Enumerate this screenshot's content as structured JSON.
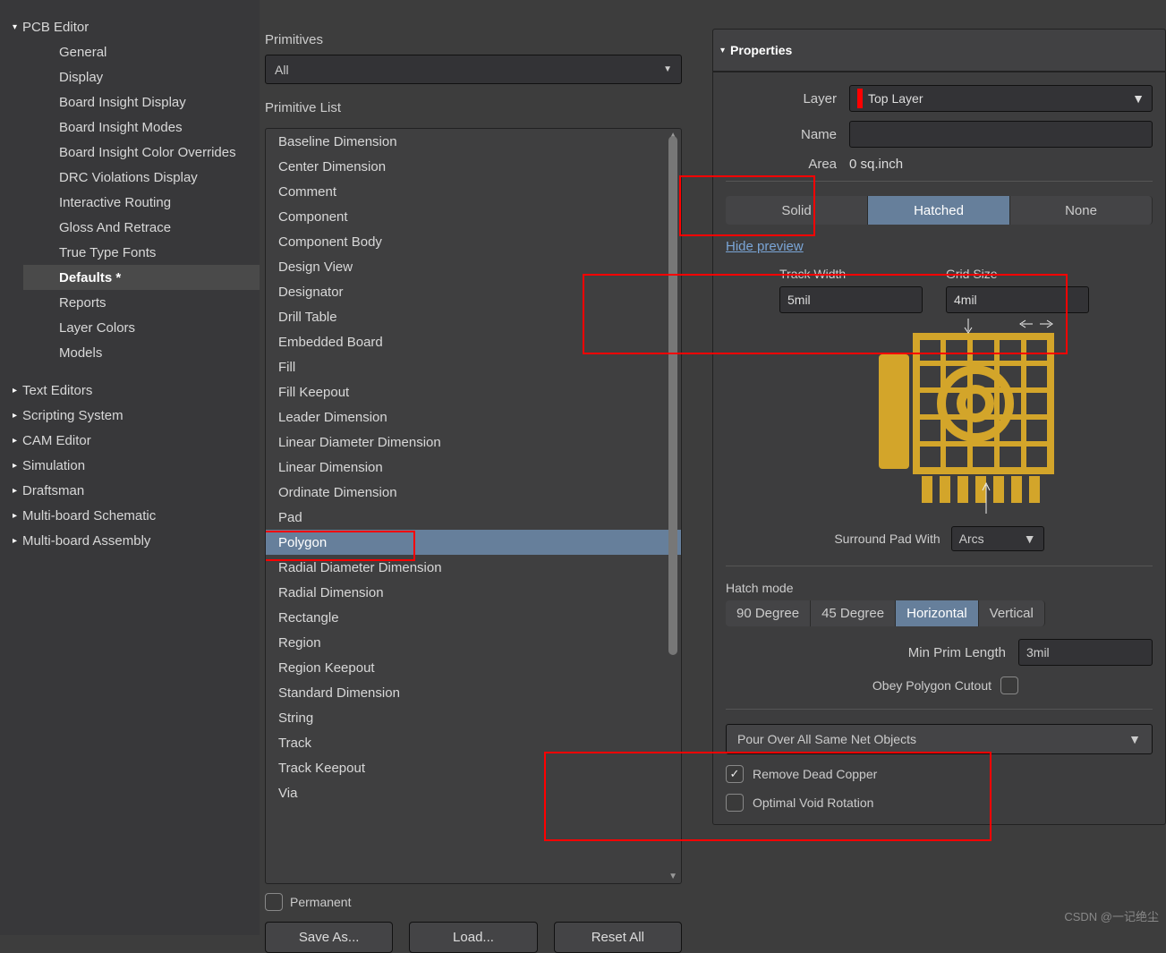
{
  "sidebar": {
    "pcb_editor": "PCB Editor",
    "items": [
      "General",
      "Display",
      "Board Insight Display",
      "Board Insight Modes",
      "Board Insight Color Overrides",
      "DRC Violations Display",
      "Interactive Routing",
      "Gloss And Retrace",
      "True Type Fonts",
      "Defaults *",
      "Reports",
      "Layer Colors",
      "Models"
    ],
    "collapsed": [
      "Text Editors",
      "Scripting System",
      "CAM Editor",
      "Simulation",
      "Draftsman",
      "Multi-board Schematic",
      "Multi-board Assembly"
    ]
  },
  "middle": {
    "primitives_label": "Primitives",
    "primitives_value": "All",
    "primitive_list_label": "Primitive List",
    "items": [
      "Baseline Dimension",
      "Center Dimension",
      "Comment",
      "Component",
      "Component Body",
      "Design View",
      "Designator",
      "Drill Table",
      "Embedded Board",
      "Fill",
      "Fill Keepout",
      "Leader Dimension",
      "Linear Diameter Dimension",
      "Linear Dimension",
      "Ordinate Dimension",
      "Pad",
      "Polygon",
      "Radial Diameter Dimension",
      "Radial Dimension",
      "Rectangle",
      "Region",
      "Region Keepout",
      "Standard Dimension",
      "String",
      "Track",
      "Track Keepout",
      "Via"
    ],
    "selected_index": 16,
    "permanent_label": "Permanent",
    "save_as": "Save As...",
    "load": "Load...",
    "reset_all": "Reset All"
  },
  "properties": {
    "header": "Properties",
    "layer_label": "Layer",
    "layer_value": "Top Layer",
    "name_label": "Name",
    "name_value": "",
    "area_label": "Area",
    "area_value": "0 sq.inch",
    "fill_modes": [
      "Solid",
      "Hatched",
      "None"
    ],
    "fill_mode_active": 1,
    "hide_preview": "Hide preview",
    "track_width_label": "Track Width",
    "track_width_value": "5mil",
    "grid_size_label": "Grid Size",
    "grid_size_value": "4mil",
    "surround_label": "Surround Pad With",
    "surround_value": "Arcs",
    "hatch_mode_label": "Hatch mode",
    "hatch_modes": [
      "90 Degree",
      "45 Degree",
      "Horizontal",
      "Vertical"
    ],
    "hatch_mode_active": 2,
    "min_prim_label": "Min Prim Length",
    "min_prim_value": "3mil",
    "obey_cutout_label": "Obey Polygon Cutout",
    "pour_value": "Pour Over All Same Net Objects",
    "remove_dead_label": "Remove Dead Copper",
    "optimal_void_label": "Optimal Void Rotation"
  },
  "watermark": "CSDN @一记绝尘"
}
